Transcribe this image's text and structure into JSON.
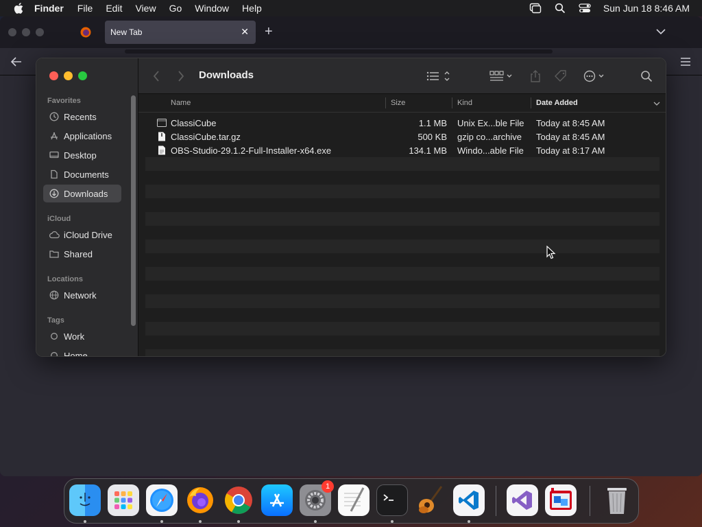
{
  "menubar": {
    "app_name": "Finder",
    "items": [
      "File",
      "Edit",
      "View",
      "Go",
      "Window",
      "Help"
    ],
    "clock": "Sun Jun 18  8:46 AM"
  },
  "browser": {
    "tab_title": "New Tab",
    "tab_close": "✕",
    "new_tab": "+"
  },
  "finder": {
    "title": "Downloads",
    "sidebar": {
      "favorites_header": "Favorites",
      "favorites": [
        {
          "label": "Recents",
          "icon": "clock-icon"
        },
        {
          "label": "Applications",
          "icon": "applications-icon"
        },
        {
          "label": "Desktop",
          "icon": "desktop-icon"
        },
        {
          "label": "Documents",
          "icon": "document-icon"
        },
        {
          "label": "Downloads",
          "icon": "download-icon",
          "selected": true
        }
      ],
      "icloud_header": "iCloud",
      "icloud": [
        {
          "label": "iCloud Drive",
          "icon": "cloud-icon"
        },
        {
          "label": "Shared",
          "icon": "shared-folder-icon"
        }
      ],
      "locations_header": "Locations",
      "locations": [
        {
          "label": "Network",
          "icon": "globe-icon"
        }
      ],
      "tags_header": "Tags",
      "tags": [
        {
          "label": "Work",
          "icon": "tag-circle-icon"
        },
        {
          "label": "Home",
          "icon": "tag-circle-icon"
        }
      ]
    },
    "columns": {
      "name": "Name",
      "size": "Size",
      "kind": "Kind",
      "date_added": "Date Added"
    },
    "files": [
      {
        "name": "ClassiCube",
        "size": "1.1 MB",
        "kind": "Unix Ex...ble File",
        "date": "Today at 8:45 AM",
        "icon": "executable-icon"
      },
      {
        "name": "ClassiCube.tar.gz",
        "size": "500 KB",
        "kind": "gzip co...archive",
        "date": "Today at 8:45 AM",
        "icon": "archive-icon"
      },
      {
        "name": "OBS-Studio-29.1.2-Full-Installer-x64.exe",
        "size": "134.1 MB",
        "kind": "Windo...able File",
        "date": "Today at 8:17 AM",
        "icon": "exe-file-icon"
      }
    ]
  },
  "dock": {
    "apps": [
      {
        "name": "Finder",
        "icon": "finder-icon",
        "running": true
      },
      {
        "name": "Launchpad",
        "icon": "launchpad-icon",
        "running": false
      },
      {
        "name": "Safari",
        "icon": "safari-icon",
        "running": true
      },
      {
        "name": "Firefox",
        "icon": "firefox-icon",
        "running": true
      },
      {
        "name": "Chrome",
        "icon": "chrome-icon",
        "running": true
      },
      {
        "name": "App Store",
        "icon": "app-store-icon",
        "running": false
      },
      {
        "name": "System Settings",
        "icon": "settings-icon",
        "running": true,
        "badge": "1"
      },
      {
        "name": "TextEdit",
        "icon": "textedit-icon",
        "running": false
      },
      {
        "name": "Terminal",
        "icon": "terminal-icon",
        "running": true
      },
      {
        "name": "GarageBand",
        "icon": "garageband-icon",
        "running": false
      },
      {
        "name": "Visual Studio Code",
        "icon": "vscode-icon",
        "running": true
      },
      {
        "name": "Visual Studio",
        "icon": "visual-studio-icon",
        "running": false
      },
      {
        "name": "Parallels",
        "icon": "parallels-icon",
        "running": false
      },
      {
        "name": "Trash",
        "icon": "trash-icon",
        "running": false
      }
    ]
  }
}
